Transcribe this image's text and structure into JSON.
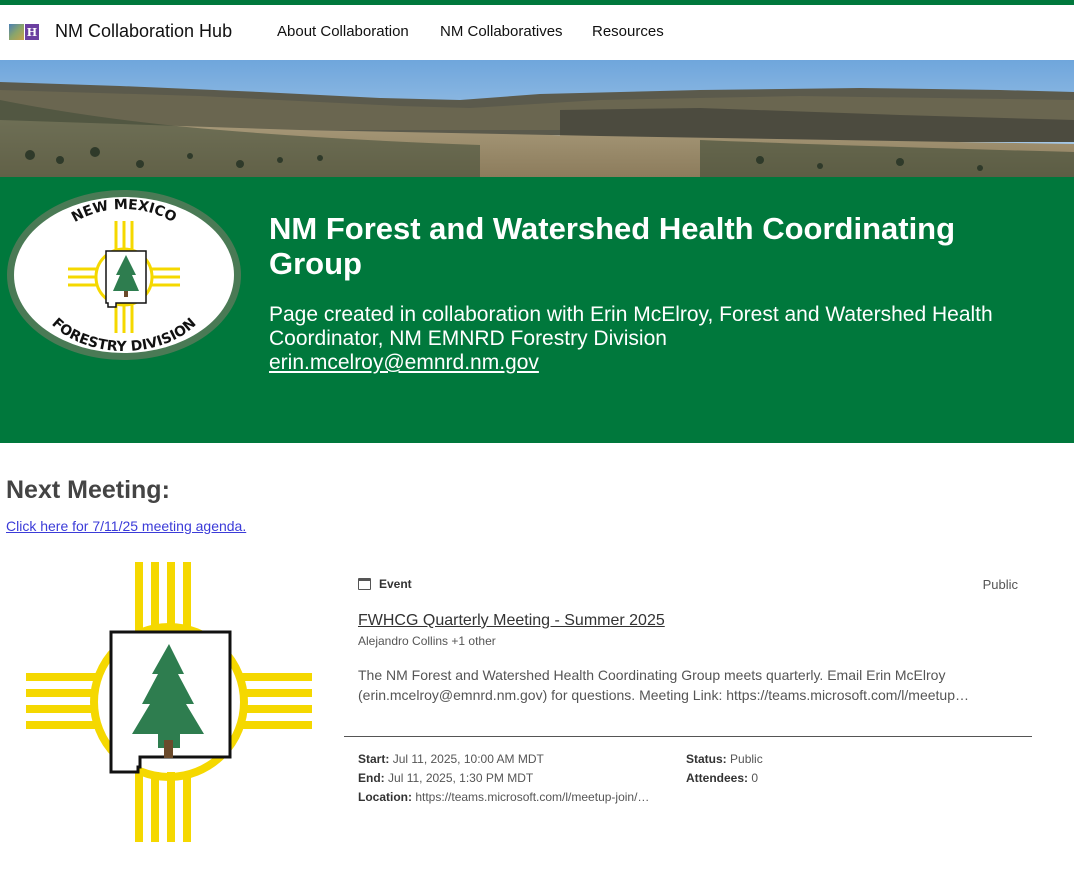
{
  "nav": {
    "site_title": "NM Collaboration Hub",
    "logo_letter": "H",
    "links": [
      "About Collaboration",
      "NM Collaboratives",
      "Resources"
    ]
  },
  "hero": {
    "title": "NM Forest and Watershed Health Coordinating Group",
    "subtitle": "Page created in collaboration with Erin McElroy, Forest and Watershed Health Coordinator, NM EMNRD Forestry Division",
    "email": "erin.mcelroy@emnrd.nm.gov",
    "seal_top_text": "NEW MEXICO",
    "seal_bottom_text": "FORESTRY DIVISION"
  },
  "meeting": {
    "heading": "Next Meeting:",
    "agenda_link": "Click here for 7/11/25 meeting agenda."
  },
  "event": {
    "type_label": "Event",
    "visibility": "Public",
    "title": "FWHCG Quarterly Meeting - Summer 2025",
    "organizers": "Alejandro Collins +1 other",
    "description": "The NM Forest and Watershed Health Coordinating Group meets quarterly. Email Erin McElroy (erin.mcelroy@emnrd.nm.gov) for questions. Meeting Link: https://teams.microsoft.com/l/meetup…",
    "start_label": "Start:",
    "start_value": "Jul 11, 2025, 10:00 AM MDT",
    "end_label": "End:",
    "end_value": "Jul 11, 2025, 1:30 PM MDT",
    "location_label": "Location:",
    "location_value": "https://teams.microsoft.com/l/meetup-join/…",
    "status_label": "Status:",
    "status_value": "Public",
    "attendees_label": "Attendees:",
    "attendees_value": "0"
  },
  "colors": {
    "brand_green": "#00783c",
    "zia_yellow": "#f5d800",
    "tree_green": "#2e7d4f",
    "link_blue": "#3b3bd8"
  }
}
